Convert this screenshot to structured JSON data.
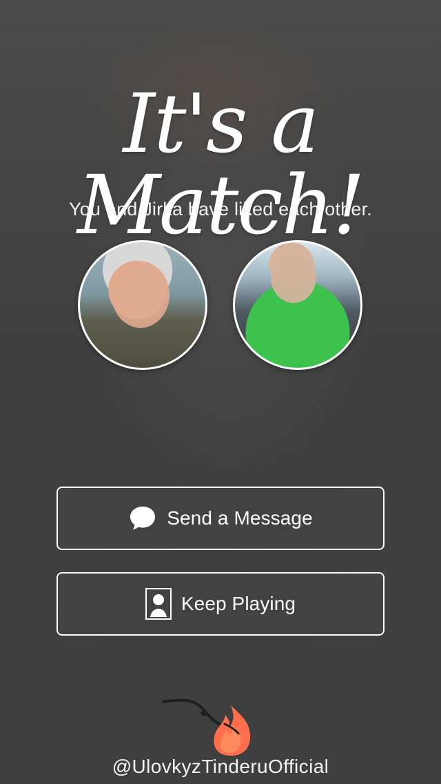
{
  "screen": {
    "title": "It's a Match!",
    "subtitle": "You and Jirka have liked each other."
  },
  "profiles": {
    "left": {
      "icon": "avatar-photo"
    },
    "right": {
      "icon": "avatar-photo"
    }
  },
  "actions": {
    "send_message": {
      "label": "Send a Message",
      "icon": "chat-bubble-icon"
    },
    "keep_playing": {
      "label": "Keep Playing",
      "icon": "person-icon"
    }
  },
  "footer": {
    "handle": "@UlovkyzTinderuOfficial",
    "icon": "fishing-hook-flame-icon"
  },
  "colors": {
    "background": "#454545",
    "text": "#ffffff",
    "flame_orange": "#ff6f4d",
    "flame_inner": "#ff8a5c"
  }
}
